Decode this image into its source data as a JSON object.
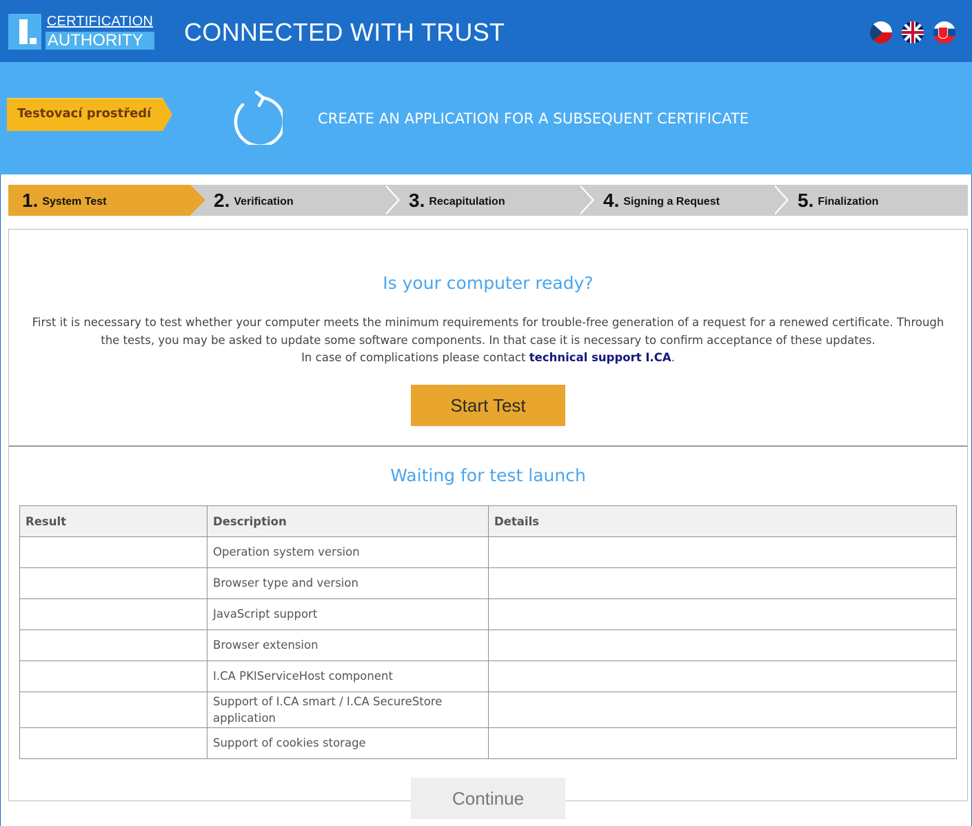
{
  "header": {
    "logo_line1": "CERTIFICATION",
    "logo_line2": "AUTHORITY",
    "slogan": "CONNECTED WITH TRUST",
    "languages": [
      "czech-flag-icon",
      "uk-flag-icon",
      "slovak-flag-icon"
    ]
  },
  "banner": {
    "env_tag": "Testovací prostředí",
    "icon": "refresh-icon",
    "title": "CREATE AN APPLICATION FOR A SUBSEQUENT CERTIFICATE"
  },
  "steps": [
    {
      "num": "1.",
      "label": "System Test",
      "active": true
    },
    {
      "num": "2.",
      "label": "Verification",
      "active": false
    },
    {
      "num": "3.",
      "label": "Recapitulation",
      "active": false
    },
    {
      "num": "4.",
      "label": "Signing a Request",
      "active": false
    },
    {
      "num": "5.",
      "label": "Finalization",
      "active": false
    }
  ],
  "ready": {
    "heading": "Is your computer ready?",
    "line1": "First it is necessary to test whether your computer meets the minimum requirements for trouble-free generation of a request for a renewed certificate. Through",
    "line2": "the tests, you may be asked to update some software components. In that case it is necessary to confirm acceptance of these updates.",
    "line3_prefix": "In case of complications please contact ",
    "support_link": "technical support I.CA",
    "line3_suffix": ".",
    "start_button": "Start Test"
  },
  "status": {
    "heading": "Waiting for test launch",
    "columns": [
      "Result",
      "Description",
      "Details"
    ],
    "rows": [
      {
        "result": "",
        "description": "Operation system version",
        "details": ""
      },
      {
        "result": "",
        "description": "Browser type and version",
        "details": ""
      },
      {
        "result": "",
        "description": "JavaScript support",
        "details": ""
      },
      {
        "result": "",
        "description": "Browser extension",
        "details": ""
      },
      {
        "result": "",
        "description": "I.CA PKIServiceHost component",
        "details": ""
      },
      {
        "result": "",
        "description": "Support of I.CA smart / I.CA SecureStore application",
        "details": ""
      },
      {
        "result": "",
        "description": "Support of cookies storage",
        "details": ""
      }
    ],
    "continue_button": "Continue"
  },
  "colors": {
    "header_blue": "#1c6ec9",
    "banner_blue": "#4dadf3",
    "accent_orange": "#e8a62e",
    "env_yellow": "#f5b71c",
    "heading_blue": "#4aa5ec",
    "link_navy": "#14197a"
  }
}
